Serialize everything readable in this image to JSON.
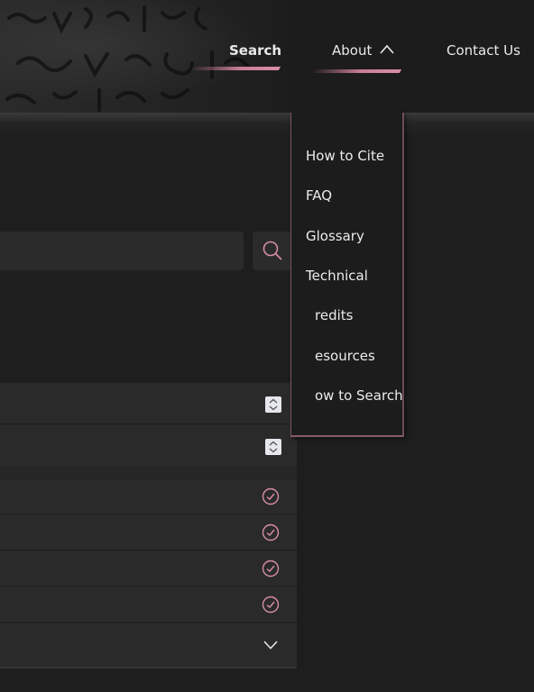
{
  "nav": {
    "search_label": "Search",
    "about_label": "About",
    "contact_label": "Contact Us"
  },
  "about_menu": {
    "items": [
      "How to Cite",
      "FAQ",
      "Glossary",
      "Technical",
      "redits",
      "esources",
      "ow to Search"
    ]
  },
  "colors": {
    "accent": "#d88ea7",
    "background": "#1e1e1e",
    "panel": "#2a2a2a",
    "text": "#e8e8e8"
  },
  "icons": {
    "search": "search-icon",
    "about_toggle": "chevron-up-icon",
    "number": "spinner-icon",
    "selected": "check-circle-icon",
    "expand": "chevron-down-icon"
  }
}
